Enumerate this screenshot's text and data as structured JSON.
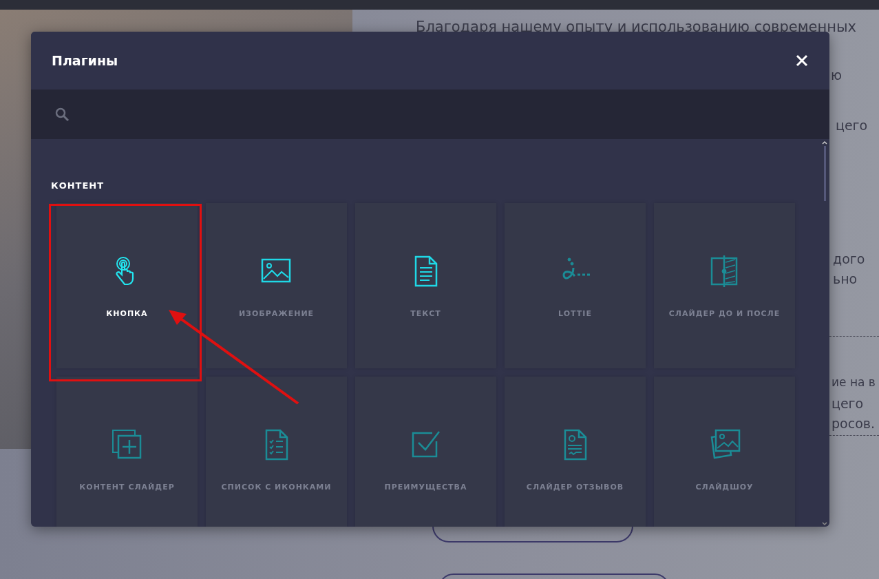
{
  "background_page": {
    "texts": [
      {
        "text": "Благодаря нашему опыту и использованию современных"
      },
      {
        "text": "ю"
      },
      {
        "text": "цего"
      },
      {
        "text": "дого"
      },
      {
        "text": "ьно"
      },
      {
        "text": "ие на в"
      },
      {
        "text": "цего"
      },
      {
        "text": "росов."
      }
    ]
  },
  "dialog": {
    "title": "Плагины",
    "sections": [
      {
        "heading": "КОНТЕНТ",
        "items": [
          {
            "label": "КНОПКА",
            "selected": true,
            "bright": true
          },
          {
            "label": "ИЗОБРАЖЕНИЕ",
            "selected": false,
            "bright": true
          },
          {
            "label": "ТЕКСТ",
            "selected": false,
            "bright": true
          },
          {
            "label": "LOTTIE",
            "selected": false,
            "bright": false
          },
          {
            "label": "СЛАЙДЕР ДО И ПОСЛЕ",
            "selected": false,
            "bright": false
          },
          {
            "label": "КОНТЕНТ СЛАЙДЕР",
            "selected": false,
            "bright": false
          },
          {
            "label": "СПИСОК С ИКОНКАМИ",
            "selected": false,
            "bright": false
          },
          {
            "label": "ПРЕИМУЩЕСТВА",
            "selected": false,
            "bright": false
          },
          {
            "label": "СЛАЙДЕР ОТЗЫВОВ",
            "selected": false,
            "bright": false
          },
          {
            "label": "СЛАЙДШОУ",
            "selected": false,
            "bright": false
          }
        ]
      }
    ]
  }
}
